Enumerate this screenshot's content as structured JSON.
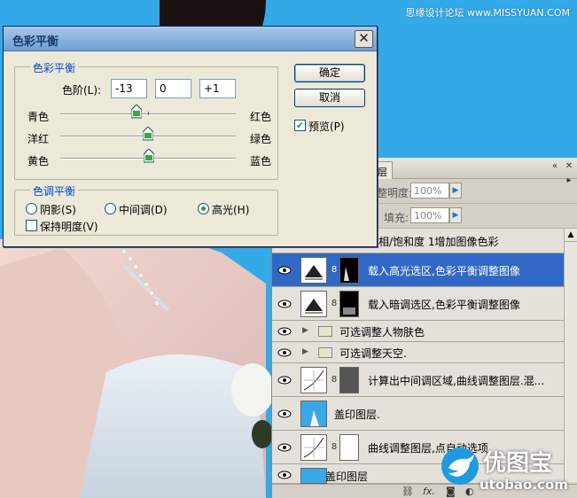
{
  "watermark": "思缘设计论坛 www.MISSYUAN.COM",
  "layers_panel": {
    "tab_label": "层",
    "opacity_label": "整明度:",
    "opacity_value": "100%",
    "fill_label": "填充:",
    "fill_value": "100%",
    "layers": [
      {
        "name": "相/饱和度 1增加图像色彩",
        "kind": "partial"
      },
      {
        "name": "载入高光选区,色彩平衡调整图像",
        "kind": "adjust",
        "selected": true
      },
      {
        "name": "载入暗调选区,色彩平衡调整图像",
        "kind": "adjust"
      },
      {
        "name": "可选调整人物肤色",
        "kind": "folder"
      },
      {
        "name": "可选调整天空.",
        "kind": "folder"
      },
      {
        "name": "计算出中间调区域,曲线调整图层.混...",
        "kind": "curves"
      },
      {
        "name": "盖印图层.",
        "kind": "photo"
      },
      {
        "name": "曲线调整图层,点自动选项",
        "kind": "curves-white"
      },
      {
        "name": "盖印图层",
        "kind": "photo-partial"
      }
    ],
    "footer_icons": [
      "link-icon",
      "fx-icon",
      "mask-icon",
      "adjustment-icon",
      "folder-icon",
      "new-layer-icon",
      "trash-icon"
    ]
  },
  "dialog": {
    "title": "色彩平衡",
    "close_glyph": "✕",
    "color_balance": {
      "legend": "色彩平衡",
      "levels_label": "色阶(L):",
      "levels": [
        "-13",
        "0",
        "+1"
      ],
      "sliders": [
        {
          "left": "青色",
          "right": "红色",
          "value": -13
        },
        {
          "left": "洋红",
          "right": "绿色",
          "value": 0
        },
        {
          "left": "黄色",
          "right": "蓝色",
          "value": 1
        }
      ]
    },
    "tone_balance": {
      "legend": "色调平衡",
      "options": [
        {
          "label": "阴影(S)",
          "selected": false
        },
        {
          "label": "中间调(D)",
          "selected": false
        },
        {
          "label": "高光(H)",
          "selected": true
        }
      ],
      "preserve_luminosity": {
        "label": "保持明度(V)",
        "checked": false
      }
    },
    "ok_label": "确定",
    "cancel_label": "取消",
    "preview": {
      "label": "预览(P)",
      "checked": true
    }
  },
  "logo": {
    "name": "优图宝",
    "url": "utobao.com"
  },
  "colors": {
    "sky": "#33a9e8",
    "selection": "#3168c5",
    "dialog_bg": "#ece9d8"
  }
}
